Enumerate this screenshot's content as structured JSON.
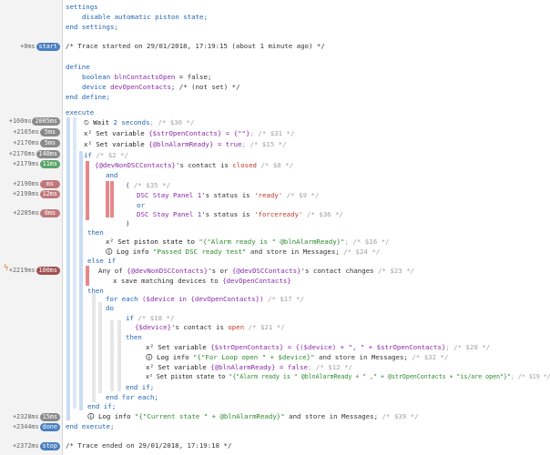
{
  "gutter": [
    {
      "label": "+0ms",
      "badge": "start",
      "kind": "blue"
    },
    {
      "label": "+160ms",
      "badge": "2005ms",
      "kind": "gray"
    },
    {
      "label": "+2165ms",
      "badge": "5ms",
      "kind": "gray"
    },
    {
      "label": "+2170ms",
      "badge": "5ms",
      "kind": "gray"
    },
    {
      "label": "+2176ms",
      "badge": "148ms",
      "kind": "gray"
    },
    {
      "label": "+2179ms",
      "badge": "11ms",
      "kind": "green"
    },
    {
      "label": "+2190ms",
      "badge": "ms",
      "kind": "red"
    },
    {
      "label": "+2190ms",
      "badge": "12ms",
      "kind": "red"
    },
    {
      "label": "+2205ms",
      "badge": "0ms",
      "kind": "red"
    },
    {
      "label": "+2219ms",
      "badge": "100ms",
      "kind": "dred"
    },
    {
      "label": "+2328ms",
      "badge": "15ms",
      "kind": "gray"
    },
    {
      "label": "+2344ms",
      "badge": "done",
      "kind": "blue"
    },
    {
      "label": "+2372ms",
      "badge": "stop",
      "kind": "blue"
    }
  ],
  "lines": {
    "l01": "settings",
    "l02": "disable automatic piston state;",
    "l03": "end settings;",
    "l04": "/* Trace started on 29/01/2018, 17:19:15 (about 1 minute ago) */",
    "l05": "define",
    "l06a": "boolean ",
    "l06b": "blnContactsOpen",
    "l06c": " = false;",
    "l07a": "device ",
    "l07b": "devOpenContacts",
    "l07c": "; /* (not set) */",
    "l08": "end define;",
    "l09": "execute",
    "l10a": "Wait ",
    "l10b": "2 seconds",
    "l10c": "; /* $30 */",
    "l11a": "Set variable ",
    "l11b": "{$strOpenContacts} = {\"\"}",
    "l11c": "; /* $31 */",
    "l12a": "Set variable ",
    "l12b": "{@blnAlarmReady} = true",
    "l12c": "; /* $15 */",
    "l13a": "if ",
    "l13b": "/* $2 */",
    "l14a": "{@devNonDSCContacts}",
    "l14b": "'s contact is ",
    "l14c": "closed",
    "l14d": " /* $8 */",
    "l15": "and",
    "l16a": "( ",
    "l16b": "/* $35 */",
    "l17a": "DSC Stay Panel 1",
    "l17b": "'s status is ",
    "l17c": "'ready'",
    "l17d": " /* $9 */",
    "l18": "or",
    "l19a": "DSC Stay Panel 1",
    "l19b": "'s status is ",
    "l19c": "'forceready'",
    "l19d": " /* $36 */",
    "l20": ")",
    "l21": "then",
    "l22a": "Set piston state to ",
    "l22b": "\"{\"Alarm ready is \" @blnAlarmReady}\"",
    "l22c": "; /* $16 */",
    "l23a": "Log info ",
    "l23b": "\"Passed DSC ready test\"",
    "l23c": " and store in Messages; ",
    "l23d": "/* $24 */",
    "l24": "else if",
    "l25a": "Any of ",
    "l25b": "{@devNonDSCContacts}",
    "l25c": "'s or ",
    "l25d": "{@devDSCContacts}",
    "l25e": "'s contact changes ",
    "l25f": "/* $23 */",
    "l26a": "x",
    "l26b": " save matching devices to ",
    "l26c": "{devOpenContacts}",
    "l27": "then",
    "l28a": "for each ",
    "l28b": "($device in {devOpenContacts})",
    "l28c": " /* $17 */",
    "l29": "do",
    "l30a": "if ",
    "l30b": "/* $18 */",
    "l31a": "{$device}",
    "l31b": "'s contact is ",
    "l31c": "open",
    "l31d": " /* $21 */",
    "l32": "then",
    "l33a": "Set variable ",
    "l33b": "{$strOpenContacts} = {($device) + \", \" + $strOpenContacts}",
    "l33c": "; /* $20 */",
    "l34a": "Log info ",
    "l34b": "\"{\"For Loop open \" + $device}\"",
    "l34c": " and store in Messages; ",
    "l34d": "/* $32 */",
    "l35a": "Set variable ",
    "l35b": "{@blnAlarmReady} = false",
    "l35c": "; /* $12 */",
    "l36a": "Set piston state to ",
    "l36b": "\"{\"Alarm ready is \" @blnAlarmReady + \" ,\" + @strOpenContacts + \"is/are open\"}\"",
    "l36c": "; /* $19 */",
    "l37": "end if;",
    "l38": "end for each;",
    "l39": "end if;",
    "l40a": "Log info ",
    "l40b": "\"{\"Current state \" + @blnAlarmReady}\"",
    "l40c": " and store in Messages; ",
    "l40d": "/* $39 */",
    "l41": "end execute;",
    "l42": "/* Trace ended on 29/01/2018, 17:19:18 */"
  },
  "icons": {
    "x": "x-squared-icon",
    "info": "info-icon",
    "clock": "clock-icon",
    "bolt": "bolt-icon"
  }
}
